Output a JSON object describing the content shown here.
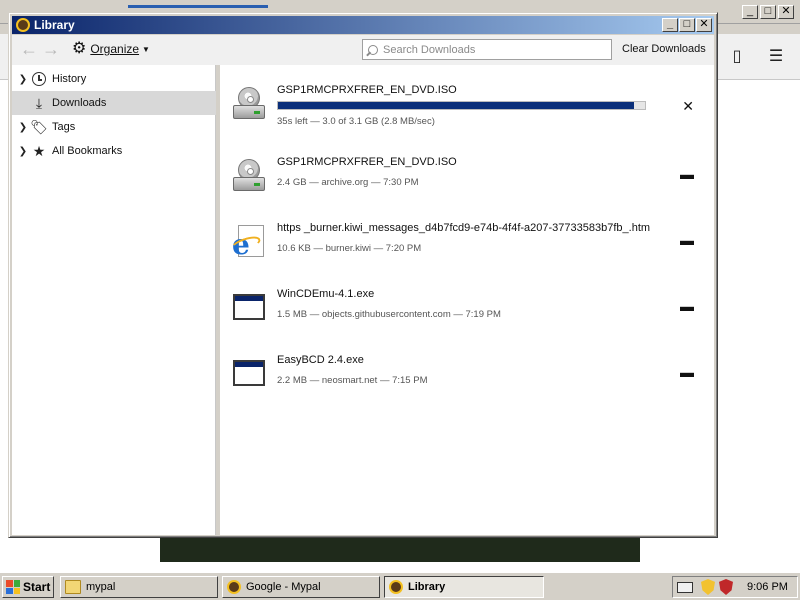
{
  "library": {
    "title": "Library",
    "controls": {
      "minimize": "_",
      "maximize": "□",
      "close": "✕"
    }
  },
  "toolbar": {
    "back": "←",
    "forward": "→",
    "organize_label": "Organize",
    "search_placeholder": "Search Downloads",
    "clear_label": "Clear Downloads"
  },
  "sidebar": {
    "items": [
      {
        "label": "History",
        "icon": "clock-icon",
        "expandable": true
      },
      {
        "label": "Downloads",
        "icon": "download-icon",
        "expandable": false,
        "selected": true
      },
      {
        "label": "Tags",
        "icon": "tag-icon",
        "expandable": true
      },
      {
        "label": "All Bookmarks",
        "icon": "star-icon",
        "expandable": true
      }
    ]
  },
  "downloads": [
    {
      "name": "GSP1RMCPRXFRER_EN_DVD.ISO",
      "meta": "35s left — 3.0 of 3.1 GB (2.8 MB/sec)",
      "in_progress": true,
      "progress": 0.97,
      "icon": "disc-icon",
      "action_icon": "cancel-icon",
      "action_glyph": "✕"
    },
    {
      "name": "GSP1RMCPRXFRER_EN_DVD.ISO",
      "meta": "2.4 GB — archive.org — 7:30 PM",
      "icon": "disc-icon",
      "action_icon": "folder-icon",
      "action_glyph": "▬"
    },
    {
      "name": "https _burner.kiwi_messages_d4b7fcd9-e74b-4f4f-a207-37733583b7fb_.htm",
      "meta": "10.6 KB — burner.kiwi — 7:20 PM",
      "icon": "ie-page-icon",
      "action_icon": "folder-icon",
      "action_glyph": "▬"
    },
    {
      "name": "WinCDEmu-4.1.exe",
      "meta": "1.5 MB — objects.githubusercontent.com — 7:19 PM",
      "icon": "exe-window-icon",
      "action_icon": "folder-icon",
      "action_glyph": "▬"
    },
    {
      "name": "EasyBCD 2.4.exe",
      "meta": "2.2 MB — neosmart.net — 7:15 PM",
      "icon": "exe-window-icon",
      "action_icon": "folder-icon",
      "action_glyph": "▬"
    }
  ],
  "taskbar": {
    "start_label": "Start",
    "tasks": [
      {
        "label": "mypal",
        "icon": "folder-icon"
      },
      {
        "label": "Google - Mypal",
        "icon": "mypal-icon"
      },
      {
        "label": "Library",
        "icon": "mypal-icon",
        "active": true
      }
    ],
    "clock": "9:06 PM"
  },
  "colors": {
    "titlebar_start": "#0a246a",
    "titlebar_end": "#a6caf0",
    "progress_fill": "#0b2f7a",
    "selected_row": "#d8d8d8"
  }
}
